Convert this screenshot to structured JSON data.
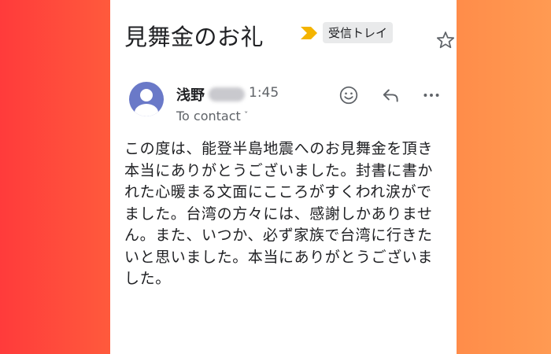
{
  "email": {
    "subject": "見舞金のお礼",
    "label": "受信トレイ",
    "sender_name": "浅野",
    "time": "1:45",
    "recipient": "To contact",
    "body": "この度は、能登半島地震へのお見舞金を頂き本当にありがとうございました。封書に書かれた心暖まる文面にこころがすくわれ涙がでました。台湾の方々には、感謝しかありません。また、いつか、必ず家族で台湾に行きたいと思いました。本当にありがとうございました。"
  },
  "icons": {
    "importance": "importance-marker-icon",
    "star": "star-icon",
    "emoji": "emoji-icon",
    "reply": "reply-icon",
    "more": "more-icon",
    "avatar": "person-icon"
  },
  "colors": {
    "importance": "#f4b400",
    "avatar_bg": "#6a79c8",
    "label_bg": "#e9eaeb"
  }
}
